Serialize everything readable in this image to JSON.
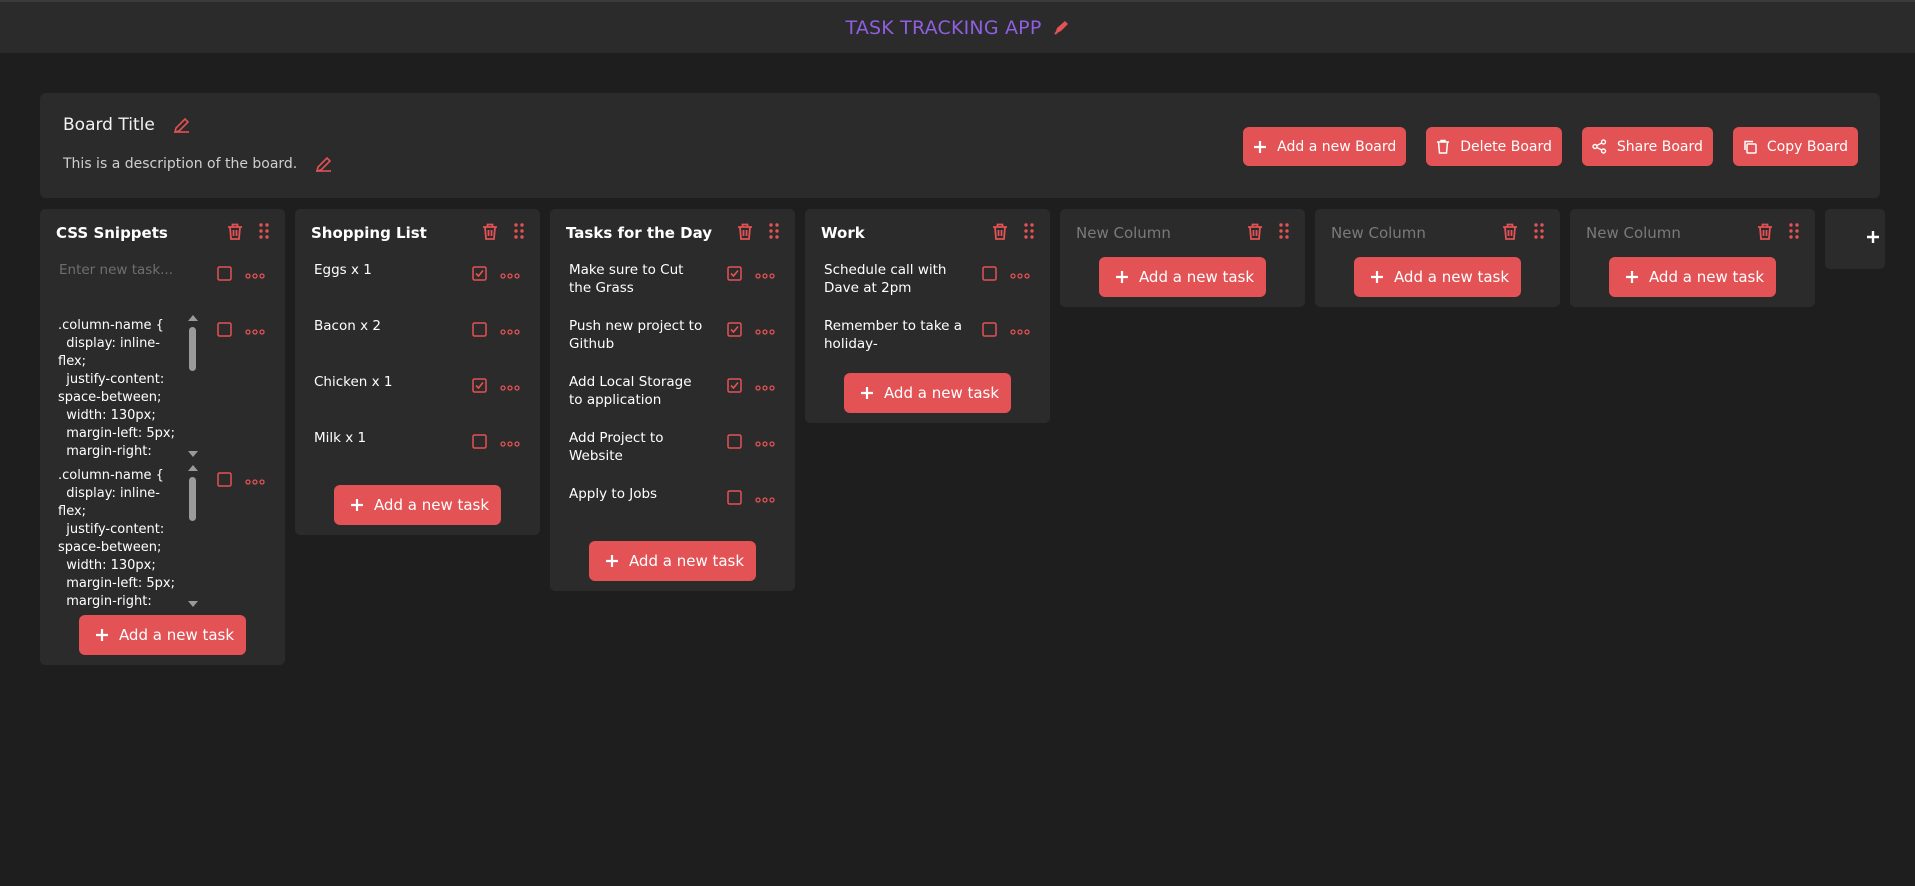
{
  "app": {
    "title": "TASK TRACKING APP"
  },
  "colors": {
    "accent": "#e35254",
    "title": "#8f5fe0",
    "panel": "#2b2b2b",
    "bg": "#1e1e1e"
  },
  "board": {
    "title": "Board Title",
    "description": "This is a description of the board.",
    "actions": [
      {
        "label": "Add a new Board",
        "icon": "plus-icon"
      },
      {
        "label": "Delete Board",
        "icon": "trash-icon"
      },
      {
        "label": "Share Board",
        "icon": "share-icon"
      },
      {
        "label": "Copy Board",
        "icon": "copy-icon"
      }
    ]
  },
  "add_task_label": "Add a new task",
  "columns": [
    {
      "name": "CSS Snippets",
      "new_task_placeholder": "Enter new task...",
      "code_tasks": [
        ".column-name {\n  display: inline-\nflex;\n  justify-content:\nspace-between;\n  width: 130px;\n  margin-left: 5px;\n  margin-right:",
        ".column-name {\n  display: inline-\nflex;\n  justify-content:\nspace-between;\n  width: 130px;\n  margin-left: 5px;\n  margin-right:"
      ]
    },
    {
      "name": "Shopping List",
      "tasks": [
        {
          "text": "Eggs x 1",
          "done": true
        },
        {
          "text": "Bacon x 2",
          "done": false
        },
        {
          "text": "Chicken x 1",
          "done": true
        },
        {
          "text": "Milk x 1",
          "done": false
        }
      ]
    },
    {
      "name": "Tasks for the Day",
      "tasks": [
        {
          "text": "Make sure to Cut the Grass",
          "done": true
        },
        {
          "text": "Push new project to Github",
          "done": true
        },
        {
          "text": "Add Local Storage to application",
          "done": true
        },
        {
          "text": "Add Project to Website",
          "done": false
        },
        {
          "text": "Apply to Jobs",
          "done": false
        }
      ]
    },
    {
      "name": "Work",
      "tasks": [
        {
          "text": "Schedule call with Dave at 2pm",
          "done": false
        },
        {
          "text": "Remember to take a holiday-",
          "done": false
        }
      ]
    },
    {
      "name": "New Column",
      "placeholder": true,
      "tasks": []
    },
    {
      "name": "New Column",
      "placeholder": true,
      "tasks": []
    },
    {
      "name": "New Column",
      "placeholder": true,
      "tasks": []
    }
  ]
}
